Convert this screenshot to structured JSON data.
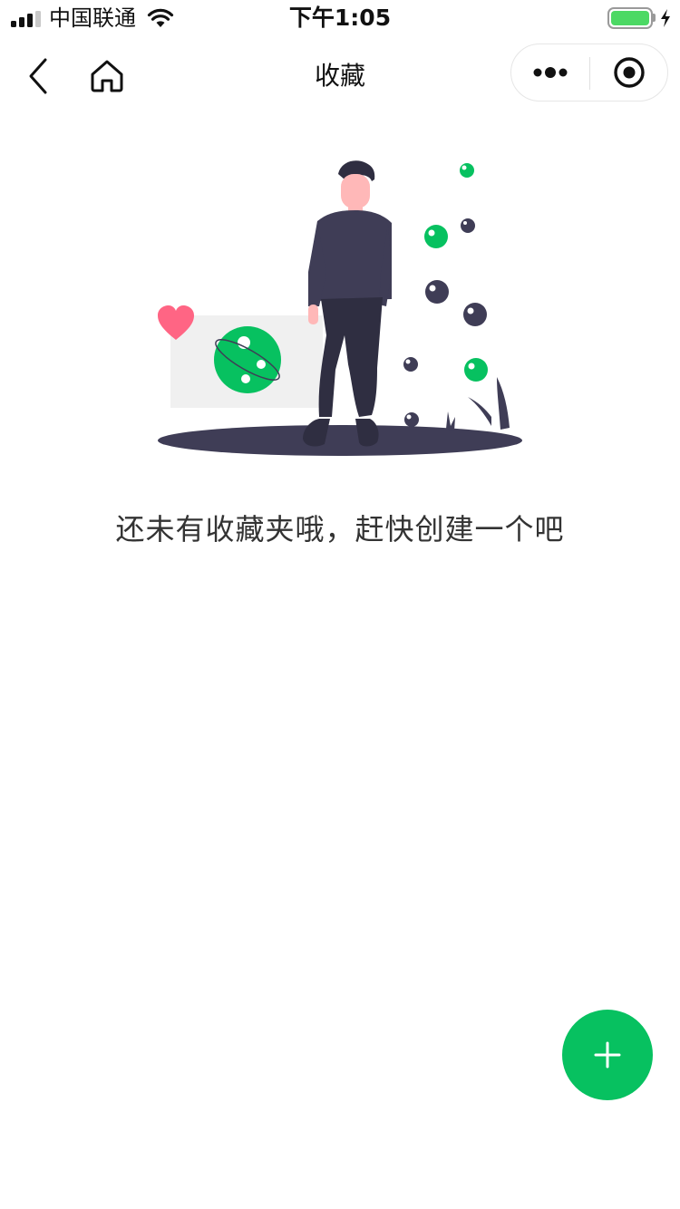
{
  "status_bar": {
    "carrier": "中国联通",
    "time": "下午1:05",
    "battery_level": 1.0,
    "icons": [
      "signal-icon",
      "wifi-icon",
      "battery-icon",
      "charging-icon"
    ]
  },
  "nav": {
    "title": "收藏",
    "icons": [
      "chevron-left-icon",
      "home-icon",
      "more-icon",
      "target-icon"
    ]
  },
  "empty_state": {
    "message": "还未有收藏夹哦，赶快创建一个吧"
  },
  "fab": {
    "icon": "plus-icon"
  },
  "colors": {
    "accent": "#07c160",
    "heart": "#ff6584",
    "figure": "#3f3d56",
    "card": "#f0f0f0",
    "battery": "#4cd964"
  }
}
